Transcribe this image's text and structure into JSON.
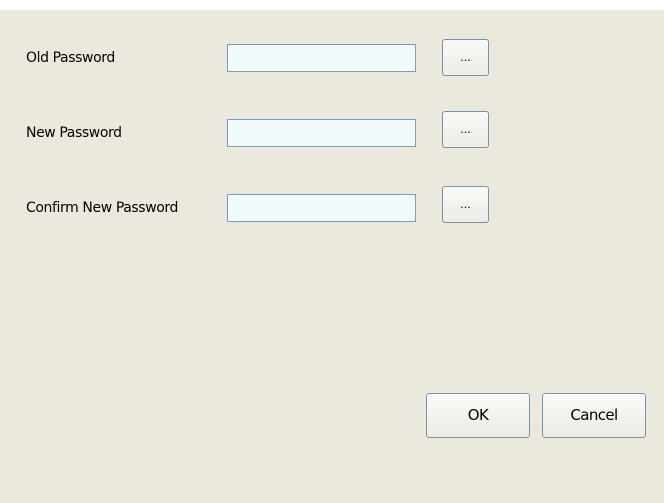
{
  "form": {
    "old_password": {
      "label": "Old Password",
      "value": "",
      "browse_label": "..."
    },
    "new_password": {
      "label": "New Password",
      "value": "",
      "browse_label": "..."
    },
    "confirm_password": {
      "label": "Confirm New Password",
      "value": "",
      "browse_label": "..."
    }
  },
  "actions": {
    "ok_label": "OK",
    "cancel_label": "Cancel"
  }
}
